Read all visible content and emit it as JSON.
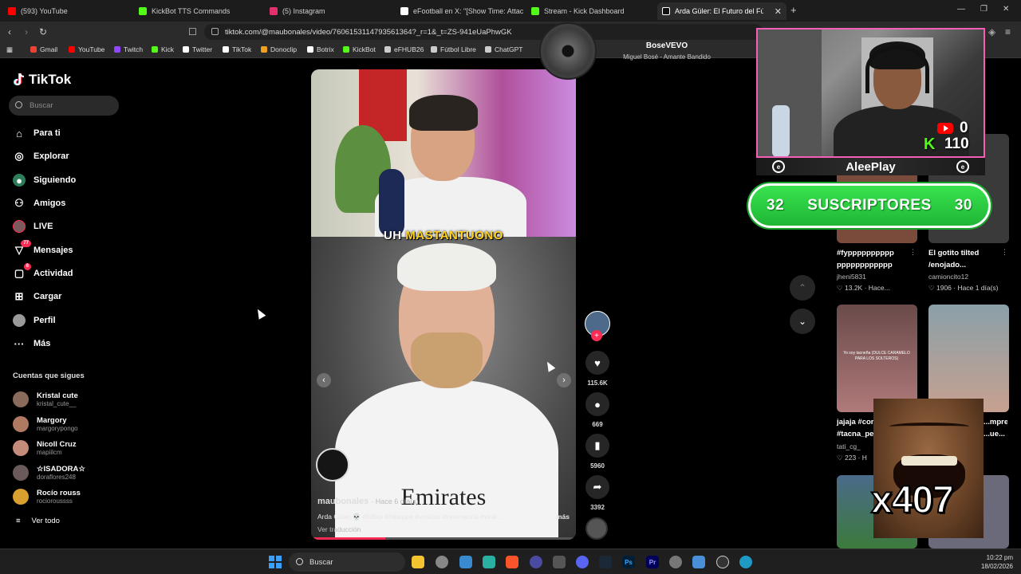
{
  "tabs": [
    {
      "label": "(593) YouTube",
      "color": "#ff0000"
    },
    {
      "label": "KickBot TTS Commands",
      "color": "#53fc18"
    },
    {
      "label": "(5) Instagram",
      "color": "#e1306c"
    },
    {
      "label": "eFootball en X: \"[Show Time: Attack",
      "color": "#ffffff"
    },
    {
      "label": "Stream - Kick Dashboard",
      "color": "#53fc18"
    },
    {
      "label": "Arda Güler: El Futuro del Fútbol",
      "color": "#ffffff"
    }
  ],
  "address": {
    "url": "tiktok.com/@maubonales/video/7606153114793561364?_r=1&_t=ZS-941eUaPhwGK"
  },
  "bookmarks": [
    {
      "label": "Gmail",
      "color": "#ea4335"
    },
    {
      "label": "YouTube",
      "color": "#ff0000"
    },
    {
      "label": "Twitch",
      "color": "#9146ff"
    },
    {
      "label": "Kick",
      "color": "#53fc18"
    },
    {
      "label": "Twitter",
      "color": "#ffffff"
    },
    {
      "label": "TikTok",
      "color": "#ffffff"
    },
    {
      "label": "Donoclip",
      "color": "#f0a020"
    },
    {
      "label": "Botrix",
      "color": "#ffffff"
    },
    {
      "label": "KickBot",
      "color": "#53fc18"
    },
    {
      "label": "eFHUB26",
      "color": "#cccccc"
    },
    {
      "label": "Fútbol Libre",
      "color": "#cccccc"
    },
    {
      "label": "ChatGPT",
      "color": "#cccccc"
    }
  ],
  "tiktok": {
    "logo": "TikTok",
    "search_placeholder": "Buscar",
    "nav": [
      {
        "label": "Para ti",
        "icon": "home-icon"
      },
      {
        "label": "Explorar",
        "icon": "compass-icon"
      },
      {
        "label": "Siguiendo",
        "icon": "following-icon"
      },
      {
        "label": "Amigos",
        "icon": "friends-icon"
      },
      {
        "label": "LIVE",
        "icon": "live-icon"
      },
      {
        "label": "Mensajes",
        "icon": "messages-icon",
        "badge": "77"
      },
      {
        "label": "Actividad",
        "icon": "activity-icon",
        "badge": "6"
      },
      {
        "label": "Cargar",
        "icon": "upload-icon"
      },
      {
        "label": "Perfil",
        "icon": "profile-icon"
      },
      {
        "label": "Más",
        "icon": "more-icon"
      }
    ],
    "following_title": "Cuentas que sigues",
    "following": [
      {
        "name": "Kristal cute",
        "handle": "kristal_cute__",
        "color": "#8a6a5a"
      },
      {
        "name": "Margory",
        "handle": "margorypongo",
        "color": "#b07a62"
      },
      {
        "name": "Nicoll Cruz",
        "handle": "mapiilcm",
        "color": "#c48a7a"
      },
      {
        "name": "☆ISADORA☆",
        "handle": "doraflores248",
        "color": "#6a5a5a"
      },
      {
        "name": "Rocío rouss",
        "handle": "rocioroussss",
        "color": "#d9a030"
      }
    ],
    "see_all": "Ver todo"
  },
  "video": {
    "caption_prefix": "UH",
    "caption_highlight": "MASTANTUONO",
    "sponsor": "Emirates",
    "author": "maubonales",
    "author_time": "· Hace 6 día(s)",
    "description": "Arda Güler 💀 #futbol #mbappe #vinicius #realmadrid #viral ...",
    "more": "más",
    "translation": "Ver traducción",
    "progress": 0.28
  },
  "actions": {
    "likes": "115.6K",
    "comments": "669",
    "saves": "5960",
    "shares": "3392"
  },
  "grid": [
    {
      "title": "#fypppppppppp pppppppppppp",
      "user": "jheni5831",
      "likes": "13.2K",
      "time": "Hace...",
      "color": "#7a4a3a"
    },
    {
      "title": "El gotito tilted /enojado...",
      "user": "camioncito12",
      "likes": "1906",
      "time": "Hace 1 día(s)",
      "color": "#3a3a3a"
    },
    {
      "title": "jajaja #cor #tacna_pe",
      "user": "tati_cg_",
      "likes": "223",
      "time": "H",
      "color": "#b07a7a",
      "overlay": "Yo soy tacneña (DULCE CARAMELO PARA LOS SOLTEROS)"
    },
    {
      "title": "...mpre ...ue...",
      "user": "",
      "likes": "",
      "time": "",
      "color": "#8aa0a8"
    }
  ],
  "stream": {
    "music_artist": "BoseVEVO",
    "music_song": "Miguel Bosé - Amante Bandido",
    "youtube_subs": "0",
    "kick_followers": "110",
    "streamer": "AleePlay",
    "subs_left": "32",
    "subs_label": "SUSCRIPTORES",
    "subs_right": "30",
    "multiplier": "x407"
  },
  "taskbar": {
    "search": "Buscar",
    "time": "10:22 pm",
    "date": "18/02/2026"
  }
}
